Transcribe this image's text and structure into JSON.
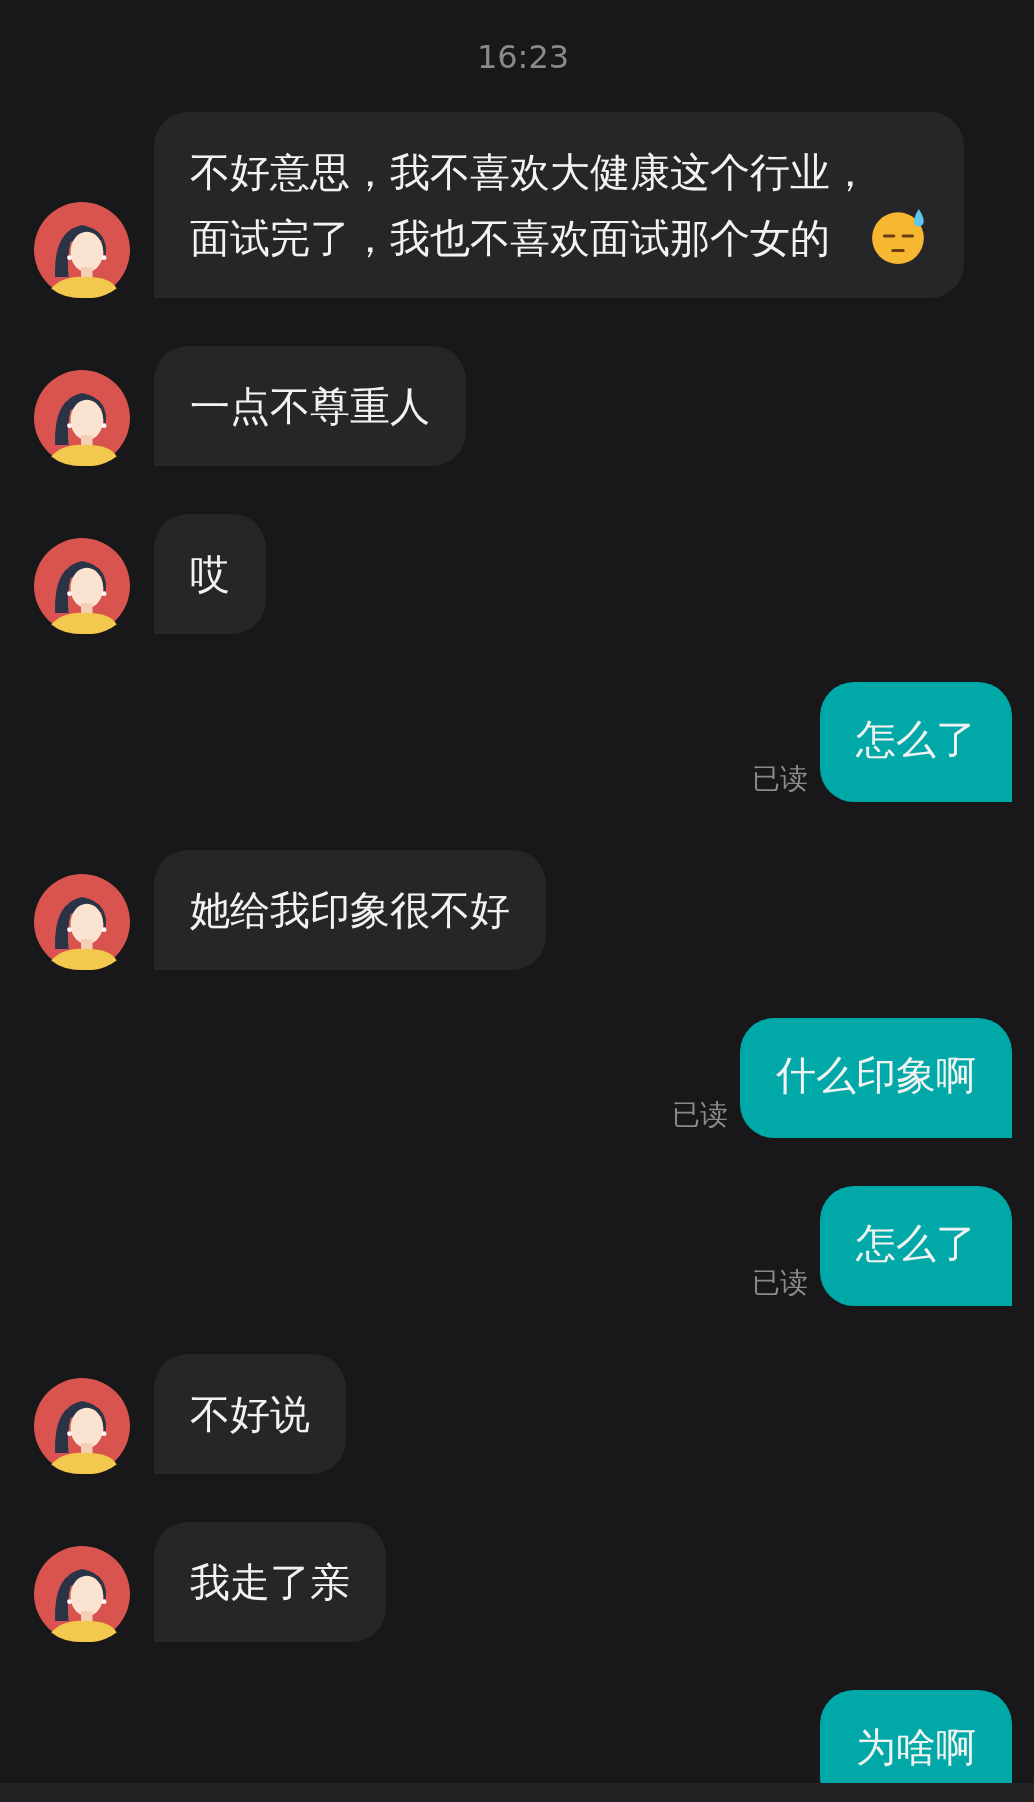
{
  "time": "16:23",
  "messages": [
    {
      "kind": "received",
      "lines": [
        "不好意思，我不喜欢大健康这个行业，",
        "面试完了，我也不喜欢面试那个女的"
      ],
      "icon": {
        "kind": "sweat"
      }
    },
    {
      "kind": "received",
      "lines": [
        "一点不尊重人"
      ]
    },
    {
      "kind": "received",
      "lines": [
        "哎"
      ]
    },
    {
      "kind": "sent",
      "lines": [
        "怎么了"
      ],
      "status": "已读"
    },
    {
      "kind": "received",
      "lines": [
        "她给我印象很不好"
      ]
    },
    {
      "kind": "sent",
      "lines": [
        "什么印象啊"
      ],
      "status": "已读"
    },
    {
      "kind": "sent",
      "lines": [
        "怎么了"
      ],
      "status": "已读"
    },
    {
      "kind": "received",
      "lines": [
        "不好说"
      ]
    },
    {
      "kind": "received",
      "lines": [
        "我走了亲"
      ]
    },
    {
      "kind": "sent",
      "lines": [
        "为啥啊"
      ]
    }
  ]
}
